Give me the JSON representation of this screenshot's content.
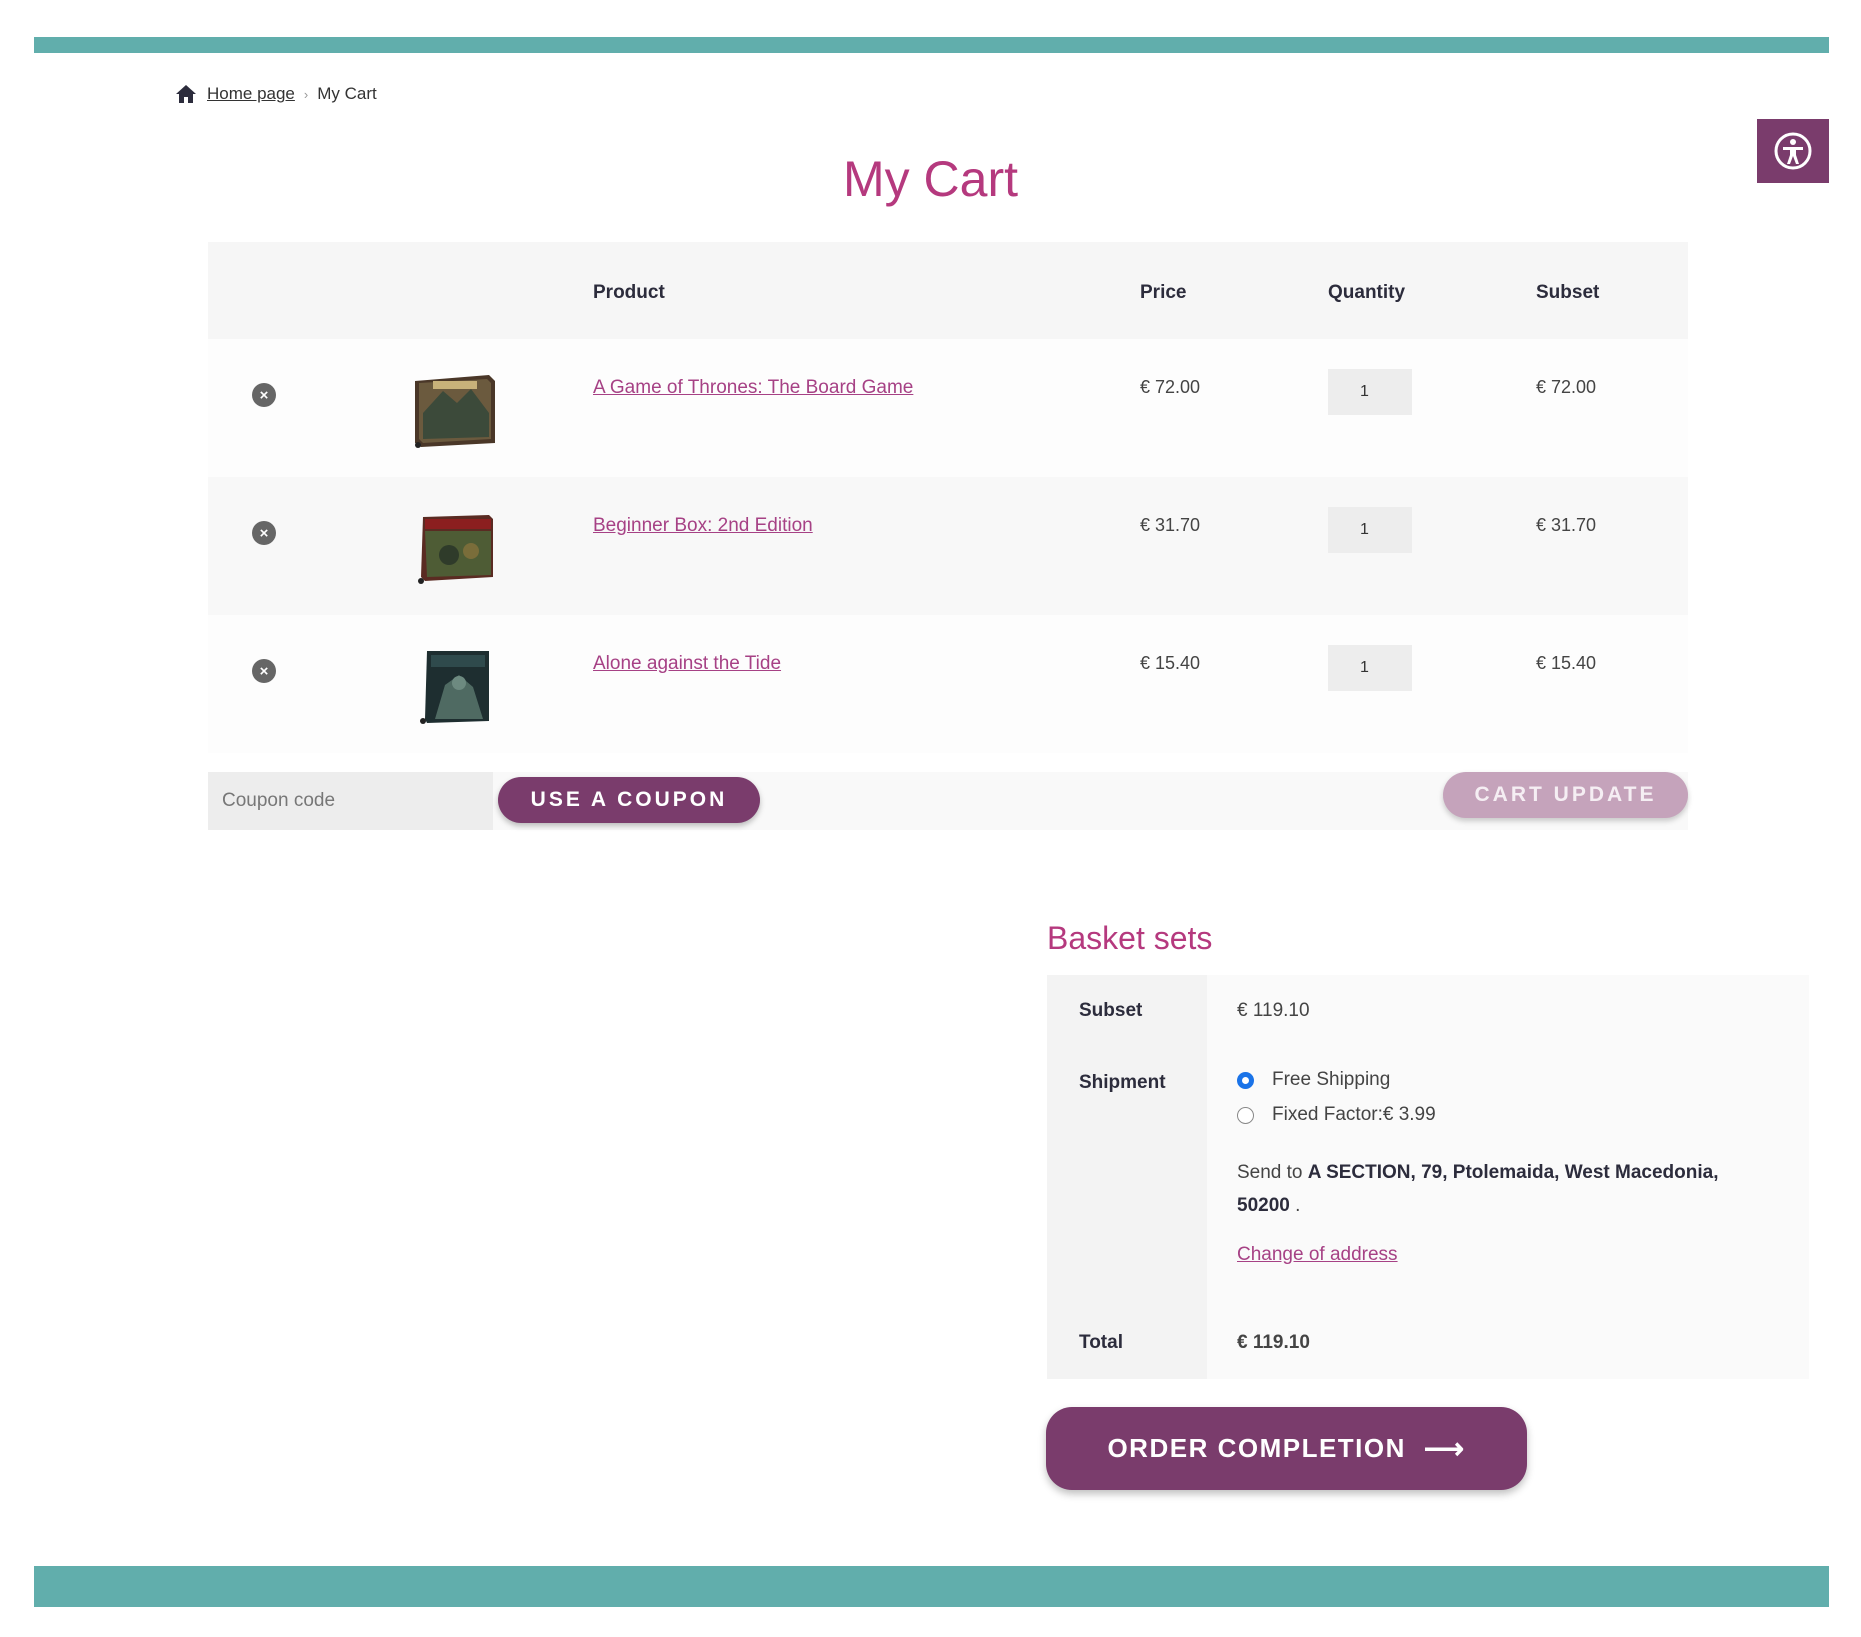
{
  "breadcrumb": {
    "home": "Home page",
    "current": "My Cart"
  },
  "page": {
    "title": "My Cart"
  },
  "table": {
    "headers": {
      "product": "Product",
      "price": "Price",
      "quantity": "Quantity",
      "subtotal": "Subset"
    },
    "items": [
      {
        "name": "A Game of Thrones: The Board Game",
        "price": "€ 72.00",
        "qty": "1",
        "subtotal": "€ 72.00",
        "remove": "×"
      },
      {
        "name": "Beginner Box: 2nd Edition",
        "price": "€ 31.70",
        "qty": "1",
        "subtotal": "€ 31.70",
        "remove": "×"
      },
      {
        "name": "Alone against the Tide",
        "price": "€ 15.40",
        "qty": "1",
        "subtotal": "€ 15.40",
        "remove": "×"
      }
    ]
  },
  "coupon": {
    "placeholder": "Coupon code",
    "apply_label": "USE A COUPON"
  },
  "cart_update": {
    "label": "CART UPDATE"
  },
  "totals": {
    "title": "Basket sets",
    "subtotal_label": "Subset",
    "subtotal_value": "€ 119.10",
    "shipping_label": "Shipment",
    "shipping_options": [
      {
        "label": "Free Shipping",
        "selected": true
      },
      {
        "label": "Fixed Factor:€ 3.99",
        "selected": false
      }
    ],
    "send_to_prefix": "Send to",
    "address": "A SECTION, 79, Ptolemaida, West Macedonia, 50200",
    "address_suffix": ".",
    "change_address": "Change of address",
    "total_label": "Total",
    "total_value": "€ 119.10"
  },
  "checkout": {
    "label": "ORDER COMPLETION",
    "arrow": "⟶"
  },
  "colors": {
    "accent": "#7a3c6c",
    "title": "#b5397e",
    "link": "#a64185",
    "bar": "#61aeac"
  },
  "icons": {
    "home": "home-icon",
    "accessibility": "accessibility-icon",
    "remove": "remove-circle-icon"
  }
}
